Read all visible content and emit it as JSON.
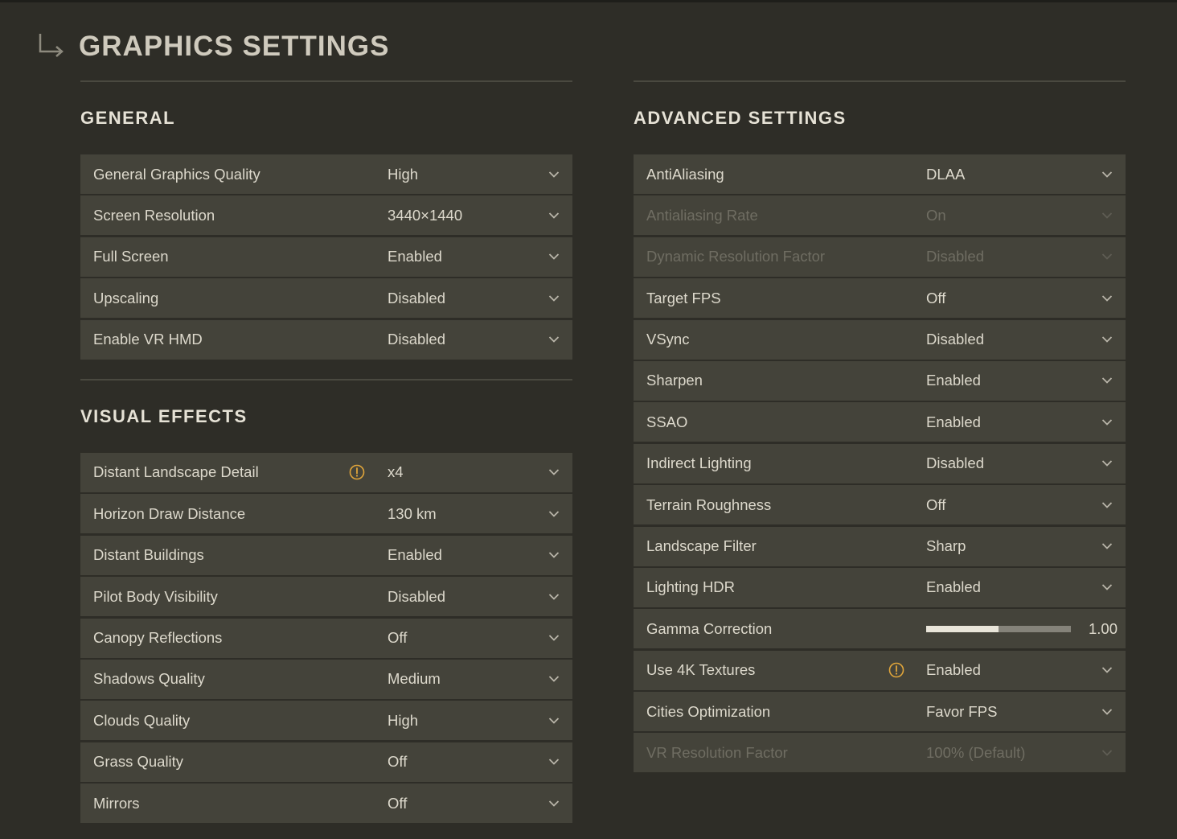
{
  "header": {
    "title": "GRAPHICS SETTINGS",
    "icon": "return-arrow-icon"
  },
  "colors": {
    "background": "#2e2d27",
    "row": "#44433a",
    "warning": "#e0a53a"
  },
  "general": {
    "title": "GENERAL",
    "rows": [
      {
        "label": "General Graphics Quality",
        "value": "High"
      },
      {
        "label": "Screen Resolution",
        "value": "3440×1440"
      },
      {
        "label": "Full Screen",
        "value": "Enabled"
      },
      {
        "label": "Upscaling",
        "value": "Disabled"
      },
      {
        "label": "Enable VR HMD",
        "value": "Disabled"
      }
    ]
  },
  "visual_effects": {
    "title": "VISUAL EFFECTS",
    "rows": [
      {
        "label": "Distant Landscape Detail",
        "value": "x4",
        "warning": true
      },
      {
        "label": "Horizon Draw Distance",
        "value": "130 km"
      },
      {
        "label": "Distant Buildings",
        "value": "Enabled"
      },
      {
        "label": "Pilot Body Visibility",
        "value": "Disabled"
      },
      {
        "label": "Canopy Reflections",
        "value": "Off"
      },
      {
        "label": "Shadows Quality",
        "value": "Medium"
      },
      {
        "label": "Clouds Quality",
        "value": "High"
      },
      {
        "label": "Grass Quality",
        "value": "Off"
      },
      {
        "label": "Mirrors",
        "value": "Off"
      }
    ]
  },
  "advanced": {
    "title": "ADVANCED SETTINGS",
    "rows": [
      {
        "label": "AntiAliasing",
        "value": "DLAA"
      },
      {
        "label": "Antialiasing Rate",
        "value": "On",
        "disabled": true
      },
      {
        "label": "Dynamic Resolution Factor",
        "value": "Disabled",
        "disabled": true
      },
      {
        "label": "Target FPS",
        "value": "Off"
      },
      {
        "label": "VSync",
        "value": "Disabled"
      },
      {
        "label": "Sharpen",
        "value": "Enabled"
      },
      {
        "label": "SSAO",
        "value": "Enabled"
      },
      {
        "label": "Indirect Lighting",
        "value": "Disabled"
      },
      {
        "label": "Terrain Roughness",
        "value": "Off"
      },
      {
        "label": "Landscape Filter",
        "value": "Sharp"
      },
      {
        "label": "Lighting HDR",
        "value": "Enabled"
      },
      {
        "label": "Gamma Correction",
        "value": "1.00",
        "slider": true,
        "slider_fraction": 0.5
      },
      {
        "label": "Use 4K Textures",
        "value": "Enabled",
        "warning": true
      },
      {
        "label": "Cities Optimization",
        "value": "Favor FPS"
      },
      {
        "label": "VR Resolution Factor",
        "value": "100% (Default)",
        "disabled": true
      }
    ]
  }
}
